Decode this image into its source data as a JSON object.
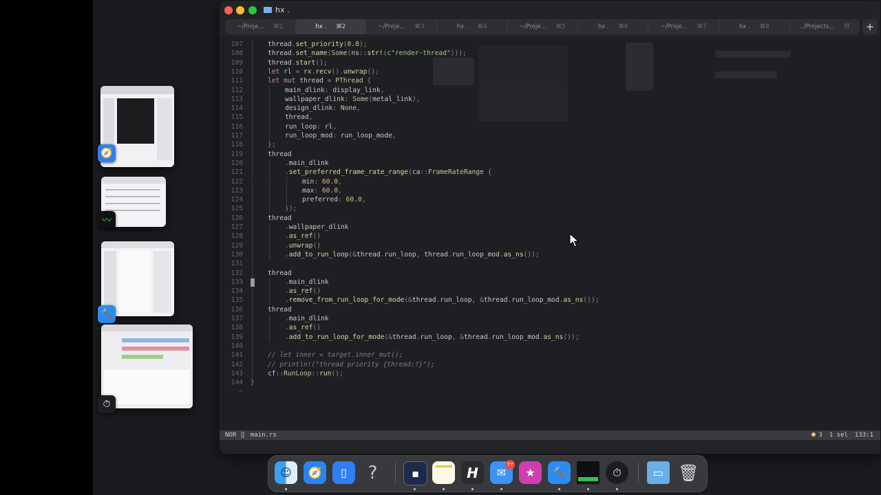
{
  "window": {
    "title": "hx .",
    "tabs": [
      {
        "label": "~/Proje...",
        "shortcut": "⌘1",
        "active": false
      },
      {
        "label": "hx .",
        "shortcut": "⌘2",
        "active": true
      },
      {
        "label": "~/Proje...",
        "shortcut": "⌘3",
        "active": false
      },
      {
        "label": "hx .",
        "shortcut": "⌘4",
        "active": false
      },
      {
        "label": "~/Proje...",
        "shortcut": "⌘5",
        "active": false
      },
      {
        "label": "hx .",
        "shortcut": "⌘6",
        "active": false
      },
      {
        "label": "~/Proje...",
        "shortcut": "⌘7",
        "active": false
      },
      {
        "label": "hx .",
        "shortcut": "⌘8",
        "active": false
      },
      {
        "label": "../Projects...",
        "shortcut": "lff",
        "active": false
      }
    ],
    "new_tab": "+"
  },
  "editor": {
    "lines": [
      {
        "n": "107",
        "indent": 1,
        "tokens": [
          [
            "fld",
            "thread"
          ],
          [
            "pr",
            "."
          ],
          [
            "fn",
            "set_priority"
          ],
          [
            "pr",
            "("
          ],
          [
            "num",
            "0.8"
          ],
          [
            "pr",
            ");"
          ]
        ]
      },
      {
        "n": "108",
        "indent": 1,
        "tokens": [
          [
            "fld",
            "thread"
          ],
          [
            "pr",
            "."
          ],
          [
            "fn",
            "set_name"
          ],
          [
            "pr",
            "("
          ],
          [
            "ty",
            "Some"
          ],
          [
            "pr",
            "("
          ],
          [
            "fld",
            "ns"
          ],
          [
            "pr",
            "::"
          ],
          [
            "fn",
            "str!"
          ],
          [
            "pr",
            "("
          ],
          [
            "str",
            "c\"render-thread\""
          ],
          [
            "pr",
            ")));"
          ]
        ]
      },
      {
        "n": "109",
        "indent": 1,
        "tokens": [
          [
            "fld",
            "thread"
          ],
          [
            "pr",
            "."
          ],
          [
            "fn",
            "start"
          ],
          [
            "pr",
            "();"
          ]
        ]
      },
      {
        "n": "110",
        "indent": 1,
        "tokens": [
          [
            "kw",
            "let"
          ],
          [
            "fld",
            " rl "
          ],
          [
            "pr",
            "= "
          ],
          [
            "fld",
            "rx"
          ],
          [
            "pr",
            "."
          ],
          [
            "fn",
            "recv"
          ],
          [
            "pr",
            "()."
          ],
          [
            "fn",
            "unwrap"
          ],
          [
            "pr",
            "();"
          ]
        ]
      },
      {
        "n": "111",
        "indent": 1,
        "tokens": [
          [
            "kw",
            "let mut"
          ],
          [
            "fld",
            " thread "
          ],
          [
            "pr",
            "= "
          ],
          [
            "ty",
            "PThread"
          ],
          [
            "pr",
            " {"
          ]
        ]
      },
      {
        "n": "112",
        "indent": 2,
        "tokens": [
          [
            "fld",
            "main_dlink"
          ],
          [
            "pr",
            ": "
          ],
          [
            "fld",
            "display_link"
          ],
          [
            "pr",
            ","
          ]
        ]
      },
      {
        "n": "113",
        "indent": 2,
        "tokens": [
          [
            "fld",
            "wallpaper_dlink"
          ],
          [
            "pr",
            ": "
          ],
          [
            "ty",
            "Some"
          ],
          [
            "pr",
            "("
          ],
          [
            "fld",
            "metal_link"
          ],
          [
            "pr",
            "),"
          ]
        ]
      },
      {
        "n": "114",
        "indent": 2,
        "tokens": [
          [
            "fld",
            "design_dlink"
          ],
          [
            "pr",
            ": "
          ],
          [
            "ty",
            "None"
          ],
          [
            "pr",
            ","
          ]
        ]
      },
      {
        "n": "115",
        "indent": 2,
        "tokens": [
          [
            "fld",
            "thread"
          ],
          [
            "pr",
            ","
          ]
        ]
      },
      {
        "n": "116",
        "indent": 2,
        "tokens": [
          [
            "fld",
            "run_loop"
          ],
          [
            "pr",
            ": "
          ],
          [
            "fld",
            "rl"
          ],
          [
            "pr",
            ","
          ]
        ]
      },
      {
        "n": "117",
        "indent": 2,
        "tokens": [
          [
            "fld",
            "run_loop_mod"
          ],
          [
            "pr",
            ": "
          ],
          [
            "fld",
            "run_loop_mode"
          ],
          [
            "pr",
            ","
          ]
        ]
      },
      {
        "n": "118",
        "indent": 1,
        "tokens": [
          [
            "pr",
            "};"
          ]
        ]
      },
      {
        "n": "119",
        "indent": 1,
        "tokens": [
          [
            "fld",
            "thread"
          ]
        ]
      },
      {
        "n": "120",
        "indent": 2,
        "tokens": [
          [
            "pr",
            "."
          ],
          [
            "fld",
            "main_dlink"
          ]
        ]
      },
      {
        "n": "121",
        "indent": 2,
        "tokens": [
          [
            "pr",
            "."
          ],
          [
            "fn",
            "set_preferred_frame_rate_range"
          ],
          [
            "pr",
            "("
          ],
          [
            "fld",
            "ca"
          ],
          [
            "pr",
            "::"
          ],
          [
            "ty",
            "FrameRateRange"
          ],
          [
            "pr",
            " {"
          ]
        ]
      },
      {
        "n": "122",
        "indent": 3,
        "tokens": [
          [
            "fld",
            "min"
          ],
          [
            "pr",
            ": "
          ],
          [
            "num",
            "60.0"
          ],
          [
            "pr",
            ","
          ]
        ]
      },
      {
        "n": "123",
        "indent": 3,
        "tokens": [
          [
            "fld",
            "max"
          ],
          [
            "pr",
            ": "
          ],
          [
            "num",
            "60.0"
          ],
          [
            "pr",
            ","
          ]
        ]
      },
      {
        "n": "124",
        "indent": 3,
        "tokens": [
          [
            "fld",
            "preferred"
          ],
          [
            "pr",
            ": "
          ],
          [
            "num",
            "60.0"
          ],
          [
            "pr",
            ","
          ]
        ]
      },
      {
        "n": "125",
        "indent": 2,
        "tokens": [
          [
            "pr",
            "});"
          ]
        ]
      },
      {
        "n": "126",
        "indent": 1,
        "tokens": [
          [
            "fld",
            "thread"
          ]
        ]
      },
      {
        "n": "127",
        "indent": 2,
        "tokens": [
          [
            "pr",
            "."
          ],
          [
            "fld",
            "wallpaper_dlink"
          ]
        ]
      },
      {
        "n": "128",
        "indent": 2,
        "tokens": [
          [
            "pr",
            "."
          ],
          [
            "fn",
            "as_ref"
          ],
          [
            "pr",
            "()"
          ]
        ]
      },
      {
        "n": "129",
        "indent": 2,
        "tokens": [
          [
            "pr",
            "."
          ],
          [
            "fn",
            "unwrap"
          ],
          [
            "pr",
            "()"
          ]
        ]
      },
      {
        "n": "130",
        "indent": 2,
        "tokens": [
          [
            "pr",
            "."
          ],
          [
            "fn",
            "add_to_run_loop"
          ],
          [
            "pr",
            "(&"
          ],
          [
            "fld",
            "thread"
          ],
          [
            "pr",
            "."
          ],
          [
            "fld",
            "run_loop"
          ],
          [
            "pr",
            ", "
          ],
          [
            "fld",
            "thread"
          ],
          [
            "pr",
            "."
          ],
          [
            "fld",
            "run_loop_mod"
          ],
          [
            "pr",
            "."
          ],
          [
            "fn",
            "as_ns"
          ],
          [
            "pr",
            "());"
          ]
        ]
      },
      {
        "n": "131",
        "indent": 1,
        "tokens": []
      },
      {
        "n": "132",
        "indent": 1,
        "tokens": [
          [
            "fld",
            "thread"
          ]
        ]
      },
      {
        "n": "133",
        "indent": 2,
        "tokens": [
          [
            "pr",
            "."
          ],
          [
            "fld",
            "main_dlink"
          ]
        ]
      },
      {
        "n": "134",
        "indent": 2,
        "tokens": [
          [
            "pr",
            "."
          ],
          [
            "fn",
            "as_ref"
          ],
          [
            "pr",
            "()"
          ]
        ]
      },
      {
        "n": "135",
        "indent": 2,
        "tokens": [
          [
            "pr",
            "."
          ],
          [
            "fn",
            "remove_from_run_loop_for_mode"
          ],
          [
            "pr",
            "(&"
          ],
          [
            "fld",
            "thread"
          ],
          [
            "pr",
            "."
          ],
          [
            "fld",
            "run_loop"
          ],
          [
            "pr",
            ", &"
          ],
          [
            "fld",
            "thread"
          ],
          [
            "pr",
            "."
          ],
          [
            "fld",
            "run_loop_mod"
          ],
          [
            "pr",
            "."
          ],
          [
            "fn",
            "as_ns"
          ],
          [
            "pr",
            "());"
          ]
        ]
      },
      {
        "n": "136",
        "indent": 1,
        "tokens": [
          [
            "fld",
            "thread"
          ]
        ]
      },
      {
        "n": "137",
        "indent": 2,
        "tokens": [
          [
            "pr",
            "."
          ],
          [
            "fld",
            "main_dlink"
          ]
        ]
      },
      {
        "n": "138",
        "indent": 2,
        "tokens": [
          [
            "pr",
            "."
          ],
          [
            "fn",
            "as_ref"
          ],
          [
            "pr",
            "()"
          ]
        ]
      },
      {
        "n": "139",
        "indent": 2,
        "tokens": [
          [
            "pr",
            "."
          ],
          [
            "fn",
            "add_to_run_loop_for_mode"
          ],
          [
            "pr",
            "(&"
          ],
          [
            "fld",
            "thread"
          ],
          [
            "pr",
            "."
          ],
          [
            "fld",
            "run_loop"
          ],
          [
            "pr",
            ", &"
          ],
          [
            "fld",
            "thread"
          ],
          [
            "pr",
            "."
          ],
          [
            "fld",
            "run_loop_mod"
          ],
          [
            "pr",
            "."
          ],
          [
            "fn",
            "as_ns"
          ],
          [
            "pr",
            "());"
          ]
        ]
      },
      {
        "n": "140",
        "indent": 1,
        "tokens": []
      },
      {
        "n": "141",
        "indent": 1,
        "tokens": [
          [
            "cm",
            "// let inner = target.inner_mut();"
          ]
        ]
      },
      {
        "n": "142",
        "indent": 1,
        "tokens": [
          [
            "cm",
            "// println!(\"thread priority {thread:?}\");"
          ]
        ]
      },
      {
        "n": "143",
        "indent": 1,
        "tokens": [
          [
            "fld",
            "cf"
          ],
          [
            "pr",
            "::"
          ],
          [
            "ty",
            "RunLoop"
          ],
          [
            "pr",
            "::"
          ],
          [
            "fn",
            "run"
          ],
          [
            "pr",
            "();"
          ]
        ]
      },
      {
        "n": "144",
        "indent": 0,
        "tokens": [
          [
            "pr",
            "}"
          ]
        ]
      },
      {
        "n": "~",
        "indent": 0,
        "tokens": []
      }
    ],
    "cursor_line": "133"
  },
  "statusbar": {
    "mode": "NOR",
    "separator": "⣿",
    "file": "main.rs",
    "diagnostics": "3",
    "selections": "1 sel",
    "position": "133:1"
  },
  "dock": {
    "mail_badge": "77",
    "icons": [
      "finder-icon",
      "safari-icon",
      "simulator-icon",
      "help-icon",
      "terminal-icon",
      "notes-icon",
      "hammer-icon",
      "mail-icon",
      "instruments-icon",
      "xcode-icon",
      "activity-monitor-icon",
      "speedometer-icon",
      "downloads-folder-icon",
      "trash-icon"
    ]
  },
  "colors": {
    "accent": "#3b86f7",
    "close": "#fe5f57",
    "minimize": "#febc2e",
    "zoom": "#28c840"
  }
}
